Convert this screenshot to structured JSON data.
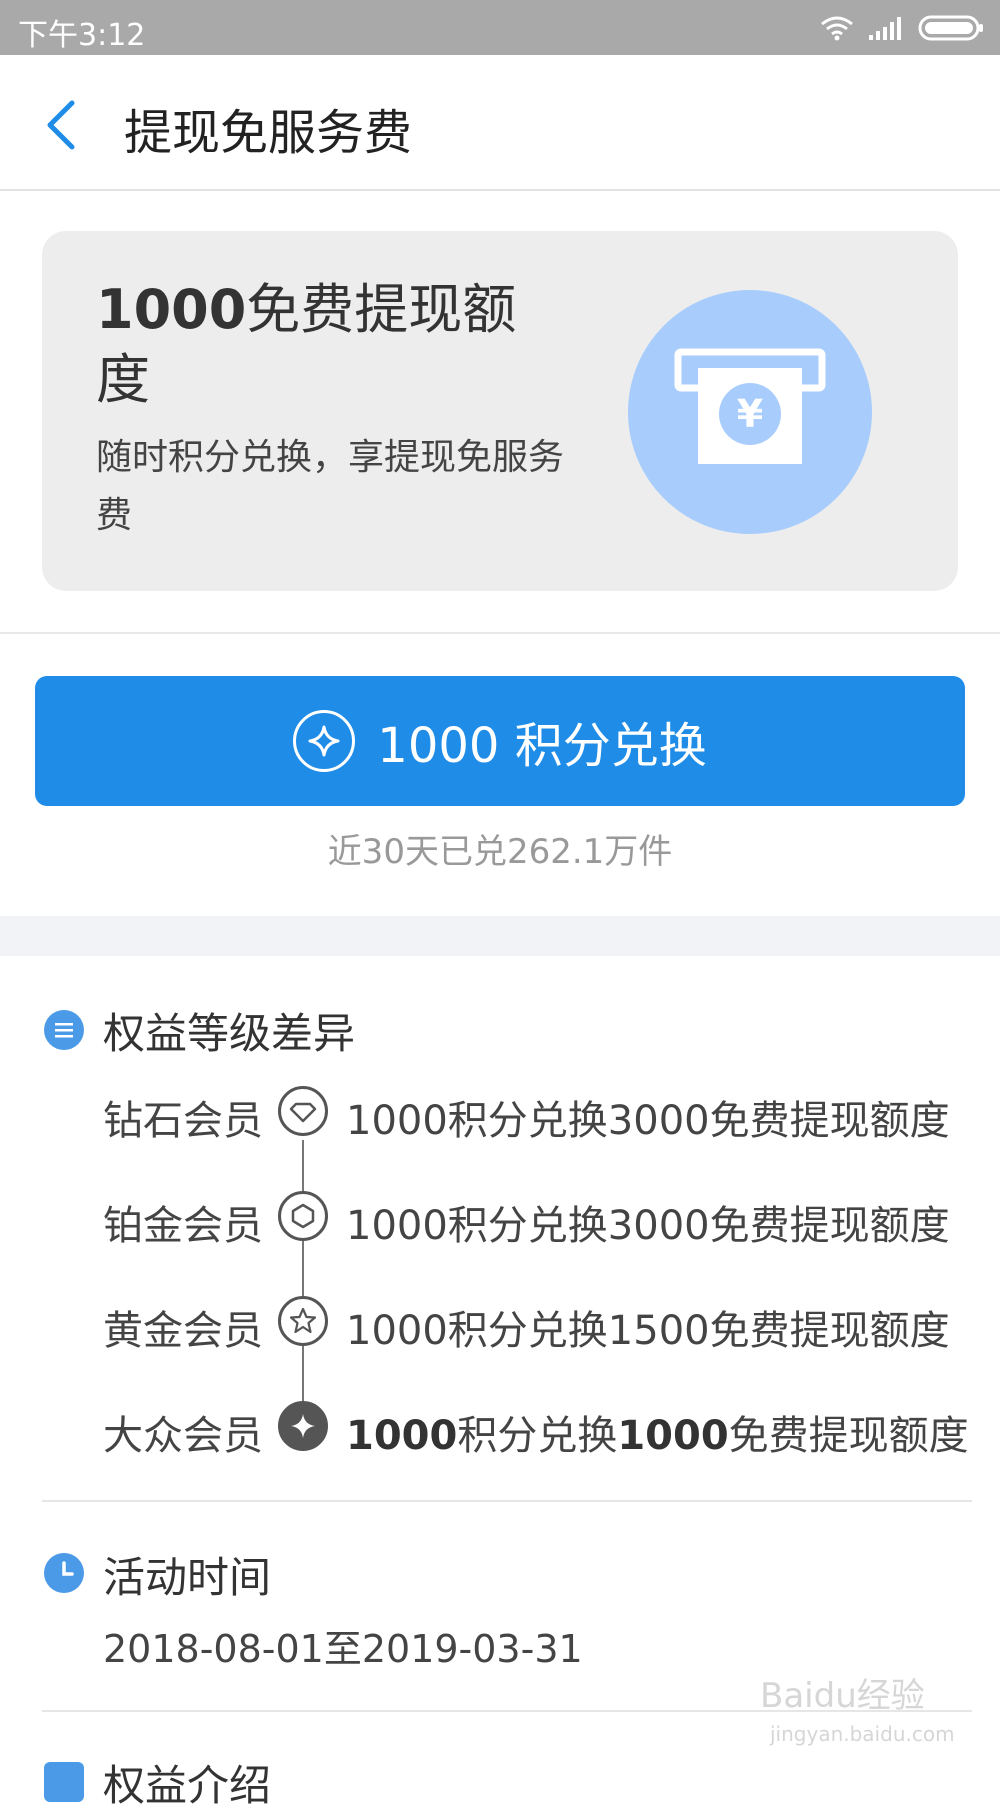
{
  "status_bar": {
    "time": "下午3:12",
    "icons": [
      "wifi-icon",
      "signal-icon",
      "battery-icon"
    ]
  },
  "header": {
    "back_icon": "chevron-left-icon",
    "title": "提现免服务费"
  },
  "card": {
    "title_number": "1000",
    "title_text": "免费提现额度",
    "subtitle": "随时积分兑换，享提现免服务费",
    "icon": "atm-yuan-icon"
  },
  "exchange": {
    "button_label": "1000 积分兑换",
    "button_icon": "sparkle-star-icon",
    "count_text": "近30天已兑262.1万件"
  },
  "tiers_section": {
    "icon": "list-icon",
    "title": "权益等级差异",
    "tiers": [
      {
        "name": "钻石会员",
        "icon": "diamond-icon",
        "desc": "1000积分兑换3000免费提现额度",
        "current": false
      },
      {
        "name": "铂金会员",
        "icon": "hexagon-icon",
        "desc": "1000积分兑换3000免费提现额度",
        "current": false
      },
      {
        "name": "黄金会员",
        "icon": "star-icon",
        "desc": "1000积分兑换1500免费提现额度",
        "current": false
      },
      {
        "name": "大众会员",
        "icon": "sparkle-icon",
        "desc_parts": [
          "1000",
          "积分兑换",
          "1000",
          "免费提现额度"
        ],
        "current": true
      }
    ]
  },
  "activity_section": {
    "icon": "clock-icon",
    "title": "活动时间",
    "date_range": "2018-08-01至2019-03-31"
  },
  "intro_section": {
    "icon": "document-icon",
    "title": "权益介绍"
  },
  "watermark": {
    "text": "Baidu经验",
    "sub": "jingyan.baidu.com"
  },
  "colors": {
    "accent": "#1f8ce8",
    "status_bar": "#a9a9a9",
    "card_bg": "#ededed",
    "card_icon_bg": "#a8cdfc",
    "section_icon": "#4a9ae8"
  }
}
